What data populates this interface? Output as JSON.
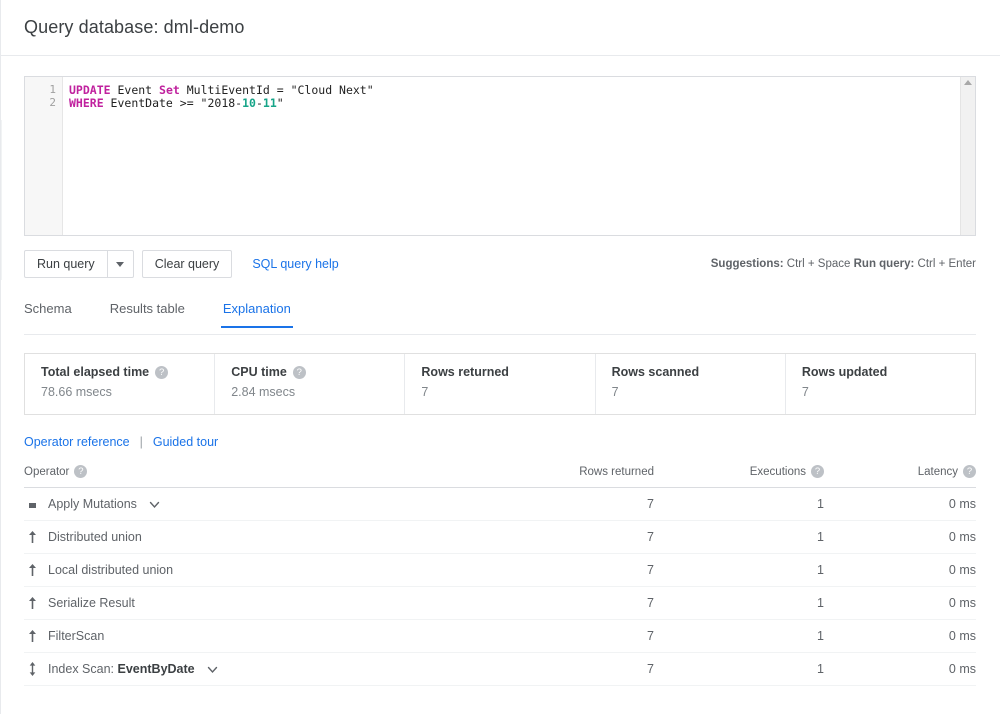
{
  "header": {
    "title": "Query database: dml-demo"
  },
  "editor": {
    "line_numbers": [
      "1",
      "2"
    ],
    "lines": [
      {
        "segments": [
          {
            "text": "UPDATE",
            "type": "keyword"
          },
          {
            "text": " Event ",
            "type": "plain"
          },
          {
            "text": "Set",
            "type": "keyword"
          },
          {
            "text": " MultiEventId = \"Cloud Next\"",
            "type": "plain"
          }
        ]
      },
      {
        "segments": [
          {
            "text": "WHERE",
            "type": "keyword"
          },
          {
            "text": " EventDate >= \"2018-",
            "type": "plain"
          },
          {
            "text": "10",
            "type": "number"
          },
          {
            "text": "-",
            "type": "plain"
          },
          {
            "text": "11",
            "type": "number"
          },
          {
            "text": "\"",
            "type": "plain"
          }
        ]
      }
    ],
    "plain_text": "UPDATE Event Set MultiEventId = \"Cloud Next\"\nWHERE EventDate >= \"2018-10-11\"",
    "scrollbar": {
      "up_arrow_icon": "triangle-up-icon"
    }
  },
  "actions": {
    "run_query_label": "Run query",
    "run_query_dropdown_icon": "caret-down-icon",
    "clear_query_label": "Clear query",
    "sql_help_label": "SQL query help",
    "shortcuts": {
      "suggestions_label": "Suggestions:",
      "suggestions_keys": "Ctrl + Space",
      "run_label": "Run query:",
      "run_keys": "Ctrl + Enter"
    }
  },
  "tabs": [
    {
      "label": "Schema",
      "active": false
    },
    {
      "label": "Results table",
      "active": false
    },
    {
      "label": "Explanation",
      "active": true
    }
  ],
  "stats": [
    {
      "label": "Total elapsed time",
      "value": "78.66 msecs",
      "help": true
    },
    {
      "label": "CPU time",
      "value": "2.84 msecs",
      "help": true
    },
    {
      "label": "Rows returned",
      "value": "7",
      "help": false
    },
    {
      "label": "Rows scanned",
      "value": "7",
      "help": false
    },
    {
      "label": "Rows updated",
      "value": "7",
      "help": false
    }
  ],
  "reference_links": {
    "operator_reference": "Operator reference",
    "separator": "|",
    "guided_tour": "Guided tour"
  },
  "operator_table": {
    "columns": [
      {
        "label": "Operator",
        "help": true,
        "align": "left"
      },
      {
        "label": "Rows returned",
        "help": false,
        "align": "right"
      },
      {
        "label": "Executions",
        "help": true,
        "align": "right"
      },
      {
        "label": "Latency",
        "help": true,
        "align": "right"
      }
    ],
    "rows": [
      {
        "icon": "square-icon",
        "label": "Apply Mutations",
        "bold_suffix": "",
        "expandable": true,
        "rows_returned": "7",
        "executions": "1",
        "latency": "0 ms"
      },
      {
        "icon": "arrow-up-icon",
        "label": "Distributed union",
        "bold_suffix": "",
        "expandable": false,
        "rows_returned": "7",
        "executions": "1",
        "latency": "0 ms"
      },
      {
        "icon": "arrow-up-icon",
        "label": "Local distributed union",
        "bold_suffix": "",
        "expandable": false,
        "rows_returned": "7",
        "executions": "1",
        "latency": "0 ms"
      },
      {
        "icon": "arrow-up-icon",
        "label": "Serialize Result",
        "bold_suffix": "",
        "expandable": false,
        "rows_returned": "7",
        "executions": "1",
        "latency": "0 ms"
      },
      {
        "icon": "arrow-up-icon",
        "label": "FilterScan",
        "bold_suffix": "",
        "expandable": false,
        "rows_returned": "7",
        "executions": "1",
        "latency": "0 ms"
      },
      {
        "icon": "arrow-up-down-icon",
        "label": "Index Scan: ",
        "bold_suffix": "EventByDate",
        "expandable": true,
        "rows_returned": "7",
        "executions": "1",
        "latency": "0 ms"
      }
    ]
  },
  "colors": {
    "accent_blue": "#1a73e8",
    "sql_keyword": "#c0219e",
    "sql_number": "#17a589",
    "text_primary": "#3c4043",
    "text_secondary": "#5f6368",
    "border": "#dadce0"
  },
  "icon_glyphs": {
    "help": "?"
  }
}
